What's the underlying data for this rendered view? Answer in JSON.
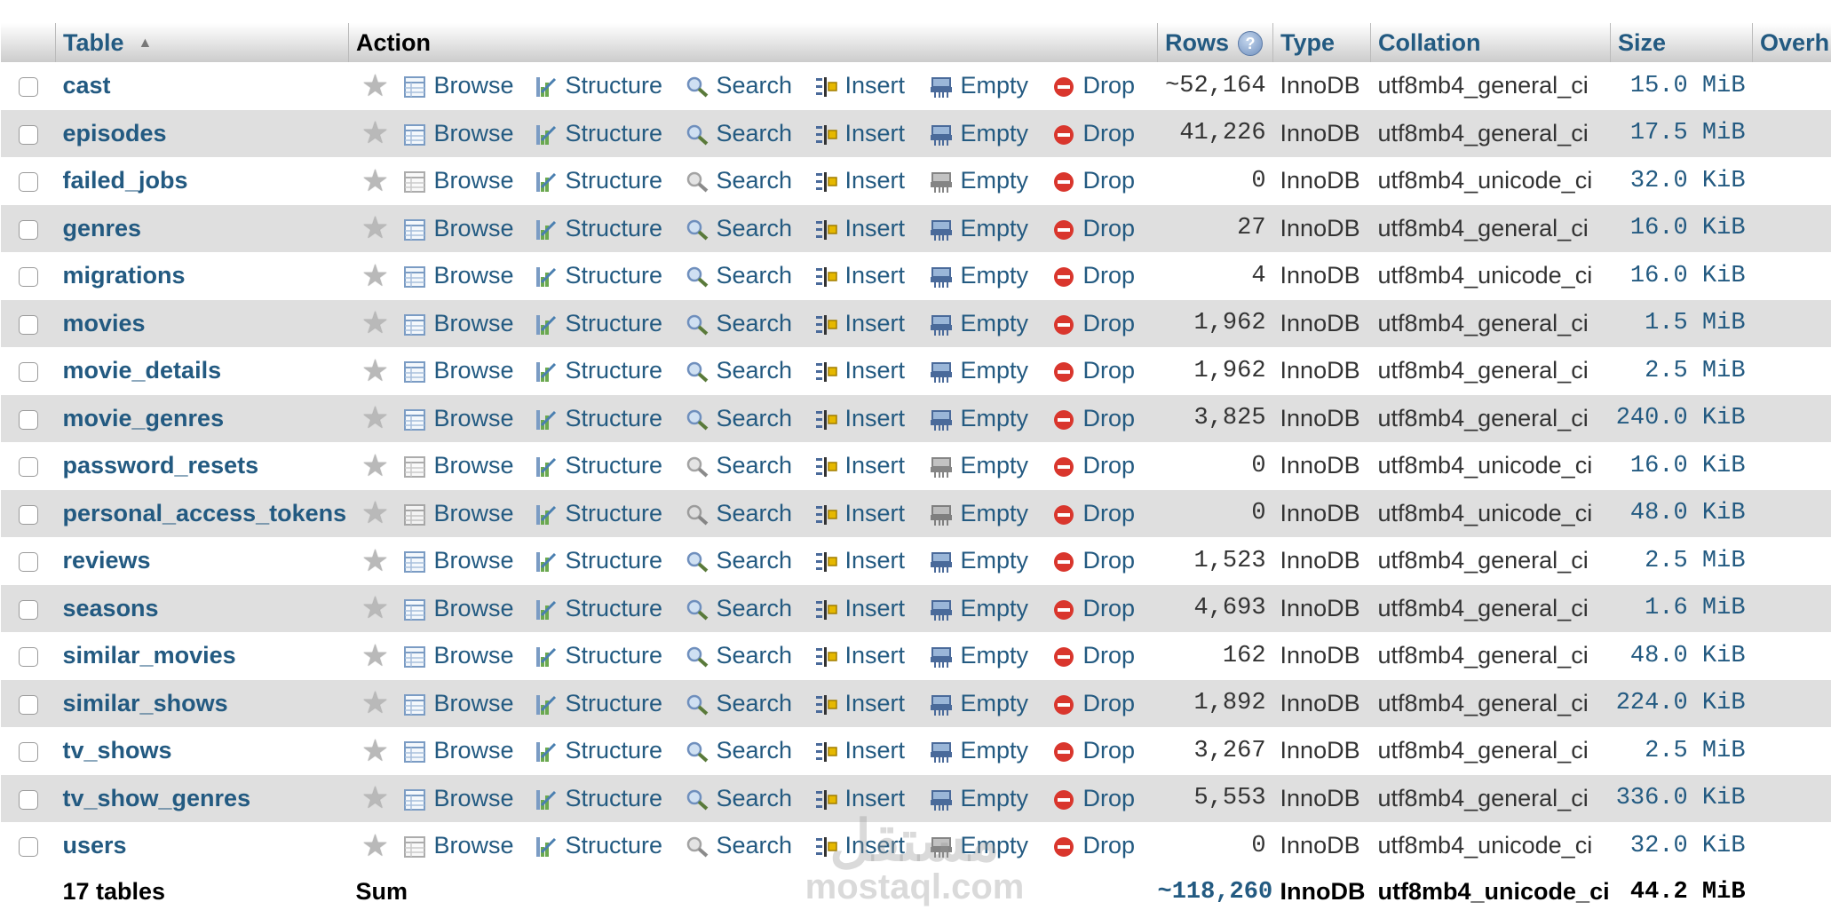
{
  "header": {
    "table": "Table",
    "action": "Action",
    "rows": "Rows",
    "type": "Type",
    "collation": "Collation",
    "size": "Size",
    "overhead": "Overh"
  },
  "actions": {
    "browse": "Browse",
    "structure": "Structure",
    "search": "Search",
    "insert": "Insert",
    "empty": "Empty",
    "drop": "Drop"
  },
  "rows": [
    {
      "name": "cast",
      "rows": "~52,164",
      "type": "InnoDB",
      "collation": "utf8mb4_general_ci",
      "size": "15.0 MiB",
      "empty": false
    },
    {
      "name": "episodes",
      "rows": "41,226",
      "type": "InnoDB",
      "collation": "utf8mb4_general_ci",
      "size": "17.5 MiB",
      "empty": false
    },
    {
      "name": "failed_jobs",
      "rows": "0",
      "type": "InnoDB",
      "collation": "utf8mb4_unicode_ci",
      "size": "32.0 KiB",
      "empty": true
    },
    {
      "name": "genres",
      "rows": "27",
      "type": "InnoDB",
      "collation": "utf8mb4_general_ci",
      "size": "16.0 KiB",
      "empty": false
    },
    {
      "name": "migrations",
      "rows": "4",
      "type": "InnoDB",
      "collation": "utf8mb4_unicode_ci",
      "size": "16.0 KiB",
      "empty": false
    },
    {
      "name": "movies",
      "rows": "1,962",
      "type": "InnoDB",
      "collation": "utf8mb4_general_ci",
      "size": "1.5 MiB",
      "empty": false
    },
    {
      "name": "movie_details",
      "rows": "1,962",
      "type": "InnoDB",
      "collation": "utf8mb4_general_ci",
      "size": "2.5 MiB",
      "empty": false
    },
    {
      "name": "movie_genres",
      "rows": "3,825",
      "type": "InnoDB",
      "collation": "utf8mb4_general_ci",
      "size": "240.0 KiB",
      "empty": false
    },
    {
      "name": "password_resets",
      "rows": "0",
      "type": "InnoDB",
      "collation": "utf8mb4_unicode_ci",
      "size": "16.0 KiB",
      "empty": true
    },
    {
      "name": "personal_access_tokens",
      "rows": "0",
      "type": "InnoDB",
      "collation": "utf8mb4_unicode_ci",
      "size": "48.0 KiB",
      "empty": true
    },
    {
      "name": "reviews",
      "rows": "1,523",
      "type": "InnoDB",
      "collation": "utf8mb4_general_ci",
      "size": "2.5 MiB",
      "empty": false
    },
    {
      "name": "seasons",
      "rows": "4,693",
      "type": "InnoDB",
      "collation": "utf8mb4_general_ci",
      "size": "1.6 MiB",
      "empty": false
    },
    {
      "name": "similar_movies",
      "rows": "162",
      "type": "InnoDB",
      "collation": "utf8mb4_general_ci",
      "size": "48.0 KiB",
      "empty": false
    },
    {
      "name": "similar_shows",
      "rows": "1,892",
      "type": "InnoDB",
      "collation": "utf8mb4_general_ci",
      "size": "224.0 KiB",
      "empty": false
    },
    {
      "name": "tv_shows",
      "rows": "3,267",
      "type": "InnoDB",
      "collation": "utf8mb4_general_ci",
      "size": "2.5 MiB",
      "empty": false
    },
    {
      "name": "tv_show_genres",
      "rows": "5,553",
      "type": "InnoDB",
      "collation": "utf8mb4_general_ci",
      "size": "336.0 KiB",
      "empty": false
    },
    {
      "name": "users",
      "rows": "0",
      "type": "InnoDB",
      "collation": "utf8mb4_unicode_ci",
      "size": "32.0 KiB",
      "empty": true
    }
  ],
  "footer": {
    "count": "17 tables",
    "sum": "Sum",
    "rows": "~118,260",
    "type": "InnoDB",
    "collation": "utf8mb4_unicode_ci",
    "size": "44.2 MiB"
  },
  "watermark": {
    "arabic": "مستقل",
    "latin": "mostaql.com"
  },
  "colors": {
    "link": "#235a81",
    "row_alt": "#dfdfdf",
    "drop_red": "#d9362d"
  }
}
